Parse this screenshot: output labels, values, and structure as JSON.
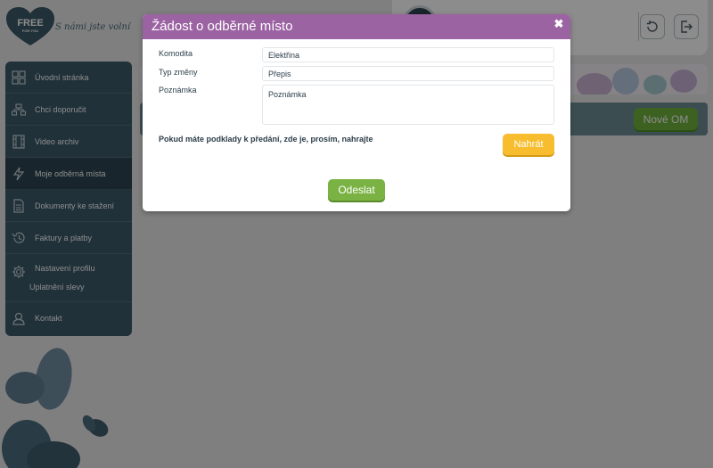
{
  "brand": {
    "logo_text": "FREE",
    "logo_sub": "FOR YOU",
    "slogan": "S námi jste volní"
  },
  "topbar": {
    "refresh_icon": "refresh-icon",
    "logout_icon": "logout-icon"
  },
  "sidebar": {
    "items": [
      {
        "label": "Úvodní stránka",
        "icon": "grid-icon"
      },
      {
        "label": "Chci doporučit",
        "icon": "network-icon"
      },
      {
        "label": "Video archiv",
        "icon": "film-icon"
      },
      {
        "label": "Moje odběrná místa",
        "icon": "lightning-icon"
      },
      {
        "label": "Dokumenty ke stažení",
        "icon": "document-icon"
      },
      {
        "label": "Faktury a platby",
        "icon": "history-icon"
      },
      {
        "label": "Nastavení profilu",
        "icon": "gear-icon"
      },
      {
        "label": "Uplatnění slevy",
        "icon": ""
      },
      {
        "label": "Kontakt",
        "icon": "person-icon"
      }
    ]
  },
  "main": {
    "new_om_button": "Nové OM"
  },
  "modal": {
    "title": "Žádost o odběrné místo",
    "close_icon": "close-icon",
    "fields": {
      "komodita_label": "Komodita",
      "komodita_value": "Elektřina",
      "typ_zmeny_label": "Typ změny",
      "typ_zmeny_value": "Přepis",
      "poznamka_label": "Poznámka",
      "poznamka_placeholder": "Poznámka"
    },
    "upload_text": "Pokud máte podklady k předání, zde je, prosím, nahrajte",
    "upload_button": "Nahrát",
    "submit_button": "Odeslat"
  },
  "colors": {
    "modal_header": "#9c63a3",
    "sidebar": "#3b5968",
    "upload_button": "#f7bd2e",
    "submit_button": "#7ab244",
    "new_om_button": "#6fb13c"
  }
}
